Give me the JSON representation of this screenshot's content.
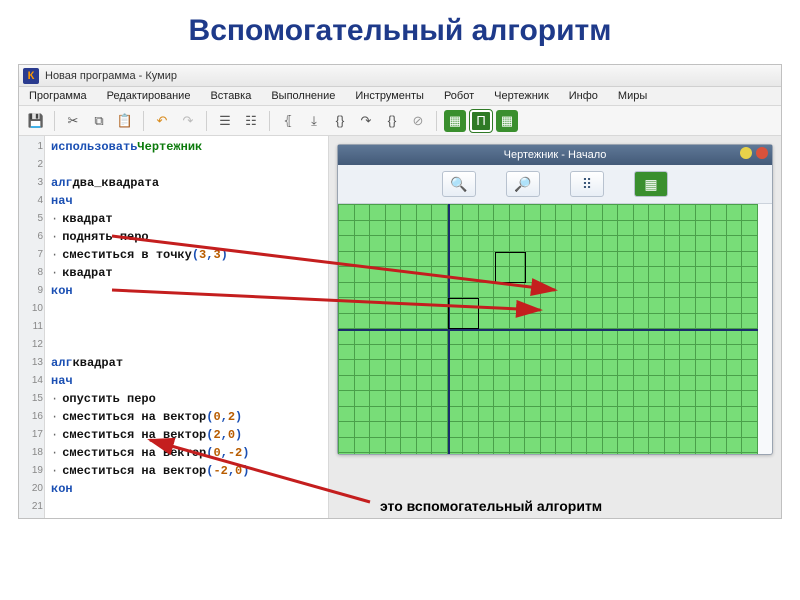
{
  "slide": {
    "title": "Вспомогательный алгоритм"
  },
  "window": {
    "title": "Новая программа - Кумир",
    "menus": [
      "Программа",
      "Редактирование",
      "Вставка",
      "Выполнение",
      "Инструменты",
      "Робот",
      "Чертежник",
      "Инфо",
      "Миры"
    ]
  },
  "toolbar": {
    "save": "save-icon",
    "cut": "cut-icon",
    "copy": "copy-icon",
    "paste": "paste-icon",
    "undo": "undo-icon",
    "redo": "redo-icon"
  },
  "code": {
    "lines": [
      {
        "n": 1,
        "parts": [
          {
            "t": "использовать ",
            "c": "kw"
          },
          {
            "t": "Чертежник",
            "c": "id"
          }
        ]
      },
      {
        "n": 2,
        "parts": []
      },
      {
        "n": 3,
        "parts": [
          {
            "t": "алг ",
            "c": "kw"
          },
          {
            "t": "два_квадрата",
            "c": "txt"
          }
        ]
      },
      {
        "n": 4,
        "parts": [
          {
            "t": "нач",
            "c": "kw"
          }
        ]
      },
      {
        "n": 5,
        "bul": true,
        "parts": [
          {
            "t": "квадрат",
            "c": "txt"
          }
        ]
      },
      {
        "n": 6,
        "bul": true,
        "parts": [
          {
            "t": "поднять перо",
            "c": "txt"
          }
        ]
      },
      {
        "n": 7,
        "bul": true,
        "parts": [
          {
            "t": "сместиться в точку",
            "c": "txt"
          },
          {
            "t": "(",
            "c": "kw"
          },
          {
            "t": "3",
            "c": "num"
          },
          {
            "t": ",",
            "c": "kw"
          },
          {
            "t": "3",
            "c": "num"
          },
          {
            "t": ")",
            "c": "kw"
          }
        ]
      },
      {
        "n": 8,
        "bul": true,
        "parts": [
          {
            "t": "квадрат",
            "c": "txt"
          }
        ]
      },
      {
        "n": 9,
        "parts": [
          {
            "t": "кон",
            "c": "kw"
          }
        ]
      },
      {
        "n": 10,
        "parts": []
      },
      {
        "n": 11,
        "parts": []
      },
      {
        "n": 12,
        "parts": []
      },
      {
        "n": 13,
        "parts": [
          {
            "t": "алг ",
            "c": "kw"
          },
          {
            "t": "квадрат",
            "c": "txt"
          }
        ]
      },
      {
        "n": 14,
        "parts": [
          {
            "t": "нач",
            "c": "kw"
          }
        ]
      },
      {
        "n": 15,
        "bul": true,
        "parts": [
          {
            "t": "опустить перо",
            "c": "txt"
          }
        ]
      },
      {
        "n": 16,
        "bul": true,
        "parts": [
          {
            "t": "сместиться на вектор",
            "c": "txt"
          },
          {
            "t": "(",
            "c": "kw"
          },
          {
            "t": "0",
            "c": "num"
          },
          {
            "t": ",",
            "c": "kw"
          },
          {
            "t": "2",
            "c": "num"
          },
          {
            "t": ")",
            "c": "kw"
          }
        ]
      },
      {
        "n": 17,
        "bul": true,
        "parts": [
          {
            "t": "сместиться на вектор",
            "c": "txt"
          },
          {
            "t": "(",
            "c": "kw"
          },
          {
            "t": "2",
            "c": "num"
          },
          {
            "t": ",",
            "c": "kw"
          },
          {
            "t": "0",
            "c": "num"
          },
          {
            "t": ")",
            "c": "kw"
          }
        ]
      },
      {
        "n": 18,
        "bul": true,
        "parts": [
          {
            "t": "сместиться на вектор",
            "c": "txt"
          },
          {
            "t": "(",
            "c": "kw"
          },
          {
            "t": "0",
            "c": "num"
          },
          {
            "t": ",",
            "c": "kw"
          },
          {
            "t": "-2",
            "c": "num"
          },
          {
            "t": ")",
            "c": "kw"
          }
        ]
      },
      {
        "n": 19,
        "bul": true,
        "parts": [
          {
            "t": "сместиться на вектор",
            "c": "txt"
          },
          {
            "t": "(",
            "c": "kw"
          },
          {
            "t": "-2",
            "c": "num"
          },
          {
            "t": ",",
            "c": "kw"
          },
          {
            "t": "0",
            "c": "num"
          },
          {
            "t": ")",
            "c": "kw"
          }
        ]
      },
      {
        "n": 20,
        "parts": [
          {
            "t": "кон",
            "c": "kw"
          }
        ]
      },
      {
        "n": 21,
        "parts": []
      }
    ]
  },
  "drafter": {
    "title": "Чертежник - Начало",
    "tools": {
      "zoom_in": "+",
      "zoom_out": "−",
      "grid": "⋮⋮⋮",
      "run": "▶"
    }
  },
  "annotation": {
    "text": "это вспомогательный алгоритм"
  },
  "chart_data": {
    "type": "diagram",
    "title": "Чертежник output",
    "grid_step": 1,
    "x_range": [
      -7,
      20
    ],
    "y_range": [
      -8,
      8
    ],
    "origin": [
      0,
      0
    ],
    "shapes": [
      {
        "type": "square",
        "x": 0,
        "y": 0,
        "size": 2
      },
      {
        "type": "square",
        "x": 3,
        "y": 3,
        "size": 2
      }
    ]
  }
}
